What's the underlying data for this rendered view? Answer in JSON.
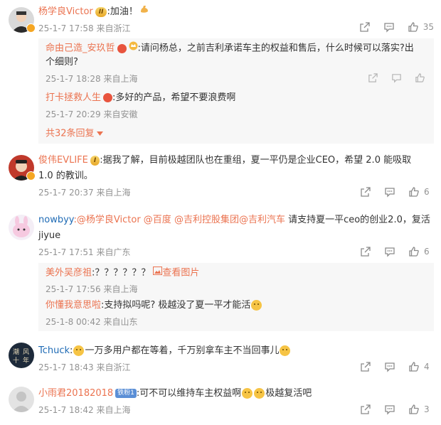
{
  "comments": [
    {
      "name": "杨学良Victor",
      "badge": "II",
      "text": ":加油！",
      "time": "25-1-7 17:58",
      "location": "来自浙江",
      "likes": "35",
      "replies": [
        {
          "name": "命由己造_安玖哲",
          "text": ":请问杨总，之前吉利承诺车主的权益和售后，什么时候可以落实?出",
          "text2": "个细则?",
          "time": "25-1-7 18:28",
          "location": "来自上海"
        },
        {
          "name": "打卡拯救人生",
          "text": ":多好的产品，希望不要浪费啊",
          "time": "25-1-7 20:29",
          "location": "来自安徽"
        }
      ],
      "more": "共32条回复"
    },
    {
      "name": "俊伟EVLIFE",
      "badge": "I",
      "text": ":据我了解，目前极越团队也在重组，夏一平仍是企业CEO，希望 2.0 能吸取",
      "text2": "1.0 的教训。",
      "time": "25-1-7 20:37",
      "location": "来自上海",
      "likes": "6"
    },
    {
      "name": "nowbyy",
      "mentions": ":@杨学良Victor @百度 @吉利控股集团@吉利汽车",
      "text": " 请支持夏一平ceo的创业2.0，复活",
      "text2": "jiyue",
      "time": "25-1-7 17:51",
      "location": "来自广东",
      "likes": "6",
      "replies": [
        {
          "name": "美外吴彦祖",
          "text": ":？？？？？？",
          "link": "查看图片",
          "time": "25-1-7 17:56",
          "location": "来自上海"
        },
        {
          "name": "你懂我意思啦",
          "text": ":支持拟吗呢? 极越没了夏一平才能活",
          "time": "25-1-8 00:42",
          "location": "来自山东"
        }
      ]
    },
    {
      "name": "Tchuck",
      "text": "一万多用户都在等着，千万别拿车主不当回事儿",
      "time": "25-1-7 18:43",
      "location": "来自浙江",
      "likes": "4"
    },
    {
      "name": "小雨君20182018",
      "badge": "铁粉1",
      "text": ":可不可以维持车主权益啊",
      "text3": "极越复活吧",
      "time": "25-1-7 18:42",
      "location": "来自上海",
      "likes": "3"
    }
  ],
  "colors": {
    "name": "#eb7350",
    "meta": "#939393",
    "reply_bg": "#f7f7f7"
  }
}
